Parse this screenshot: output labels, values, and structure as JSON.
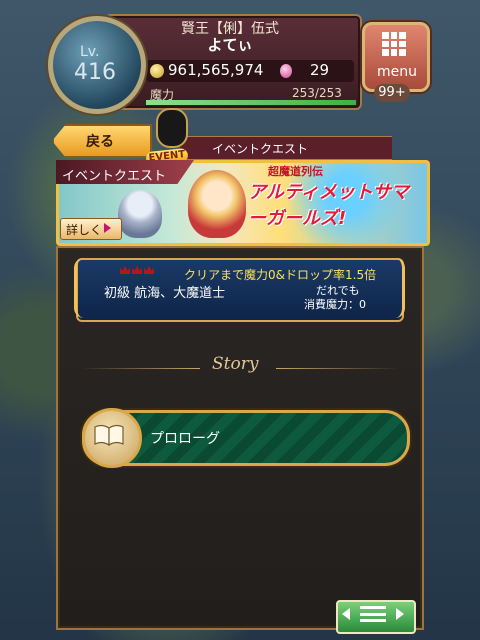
{
  "player": {
    "level_label": "Lv.",
    "level": "416",
    "title": "賢王【俐】伍式",
    "name": "よてぃ",
    "coins": "961,565,974",
    "gems": "29",
    "mana_label": "魔力",
    "mana_value": "253/253",
    "mana_fraction": 1.0
  },
  "menu": {
    "label": "menu",
    "badge": "99+"
  },
  "nav": {
    "back_label": "戻る",
    "crumb": "イベントクエスト",
    "event_tag": "EVENT"
  },
  "banner": {
    "title": "イベントクエスト",
    "logo_sub": "超魔道列伝",
    "logo_main": "アルティメットサマーガールズ!",
    "details_label": "詳しく"
  },
  "quest": {
    "bonus": "クリアまで魔力0&ドロップ率1.5倍",
    "name": "初級 航海、大魔道士",
    "who": "だれでも",
    "cost": "消費魔力：0"
  },
  "section": {
    "story_label": "Story"
  },
  "story_items": [
    {
      "label": "プロローグ"
    }
  ],
  "colors": {
    "accent_gold": "#d9a84a",
    "panel_bg": "#2a2624",
    "quest_bg": "#1a3a66",
    "prologue_green": "#0d5a3e"
  }
}
